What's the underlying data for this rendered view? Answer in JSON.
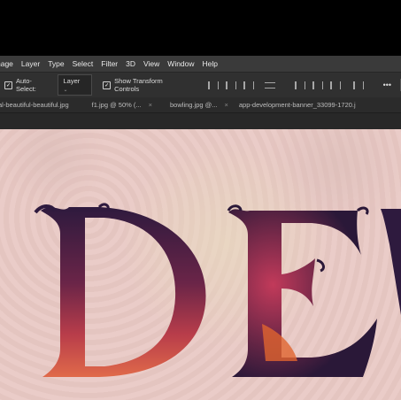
{
  "menu": [
    "Image",
    "Layer",
    "Type",
    "Select",
    "Filter",
    "3D",
    "View",
    "Window",
    "Help"
  ],
  "menu_first_display": "nage",
  "options": {
    "auto_select_label": "Auto-Select:",
    "auto_select_value": "Layer",
    "show_transform_label": "Show Transform Controls",
    "more": "•••"
  },
  "tabs": [
    {
      "label": "al-beautiful-beautiful.jpg"
    },
    {
      "label": "f1.jpg @ 50% (..."
    },
    {
      "label": "bowling.jpg @..."
    },
    {
      "label": "app-development-banner_33099-1720.j"
    }
  ],
  "canvas": {
    "text": "DEV",
    "colors": {
      "fill_dark": "#3b1d3f",
      "fill_mid": "#8b2a4a",
      "fill_warm": "#d0503a",
      "background": "#e6c6c1"
    }
  }
}
